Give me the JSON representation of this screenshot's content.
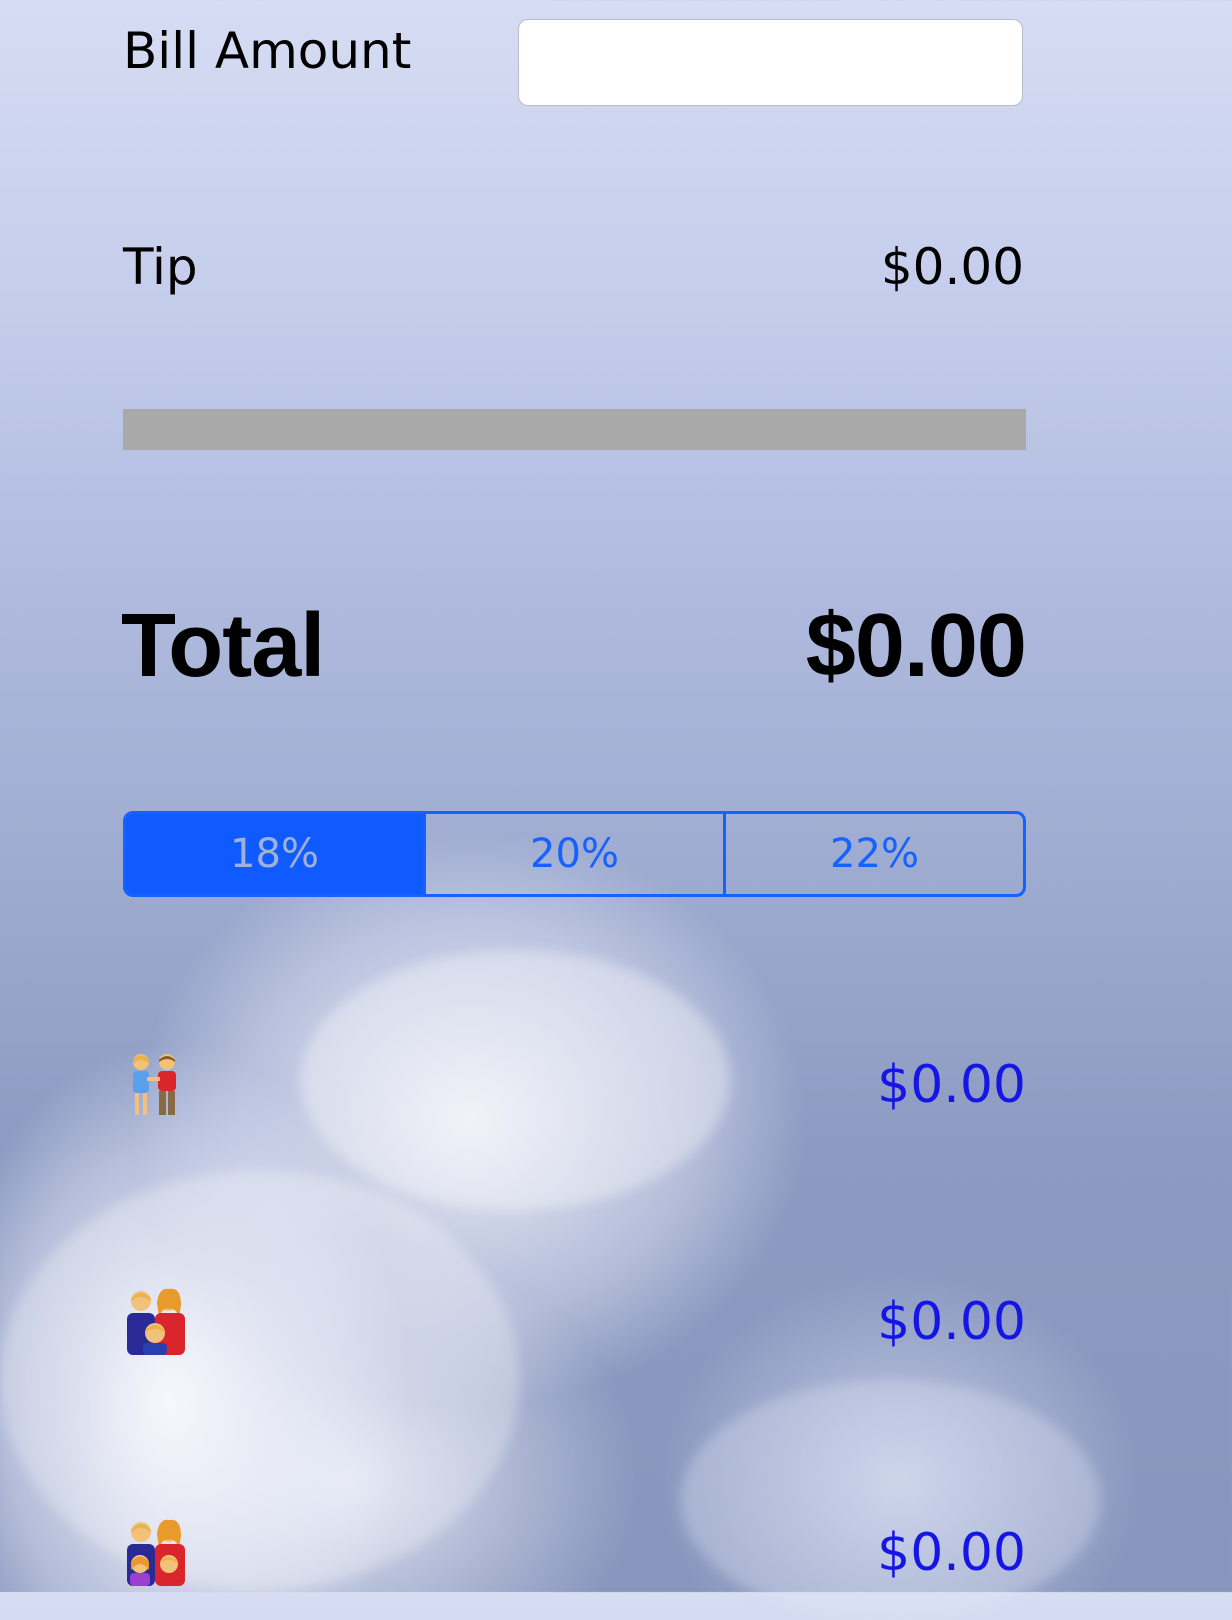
{
  "bill": {
    "label": "Bill Amount",
    "value": "",
    "placeholder": ""
  },
  "tip": {
    "label": "Tip",
    "value": "$0.00"
  },
  "total": {
    "label": "Total",
    "value": "$0.00"
  },
  "tip_options": {
    "selected": "18%",
    "options": [
      "18%",
      "20%",
      "22%"
    ]
  },
  "split": [
    {
      "icon": "couple-icon",
      "value": "$0.00"
    },
    {
      "icon": "family-three-icon",
      "value": "$0.00"
    },
    {
      "icon": "family-four-icon",
      "value": "$0.00"
    }
  ],
  "colors": {
    "accent": "#1662ff",
    "split_value": "#1515e6",
    "divider": "#a9a9a9"
  }
}
